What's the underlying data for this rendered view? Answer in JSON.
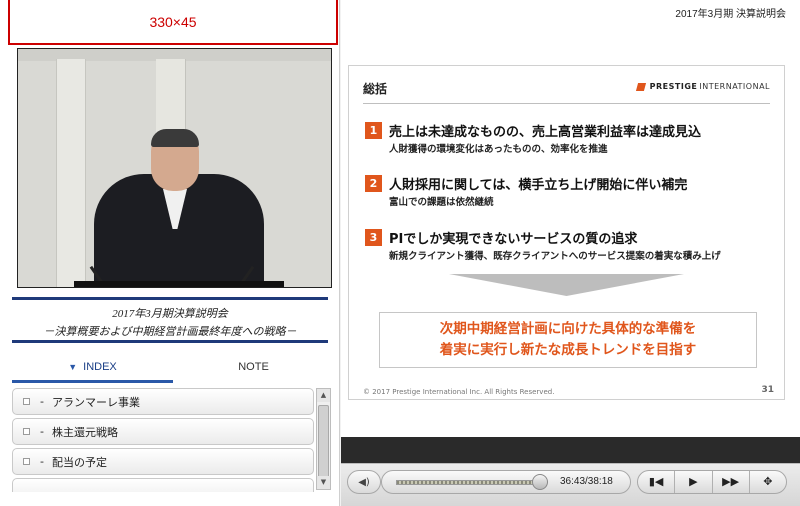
{
  "banner": {
    "text": "330×45"
  },
  "event": {
    "title_line1": "2017年3月期決算説明会",
    "title_line2": "－決算概要および中期経営計画最終年度への戦略－"
  },
  "tabs": [
    {
      "label": "INDEX",
      "active": true
    },
    {
      "label": "NOTE",
      "active": false
    }
  ],
  "index_items": [
    {
      "label": "アランマーレ事業"
    },
    {
      "label": "株主還元戦略"
    },
    {
      "label": "配当の予定"
    }
  ],
  "header": {
    "title": "2017年3月期 決算説明会"
  },
  "slide": {
    "heading": "総括",
    "logo_bold": "PRESTIGE",
    "logo_rest": "INTERNATIONAL",
    "points": [
      {
        "num": "1",
        "main": "売上は未達成なものの、売上高営業利益率は達成見込",
        "sub": "人財獲得の環境変化はあったものの、効率化を推進"
      },
      {
        "num": "2",
        "main": "人財採用に関しては、横手立ち上げ開始に伴い補完",
        "sub": "富山での課題は依然継続"
      },
      {
        "num": "3",
        "main": "PIでしか実現できないサービスの質の追求",
        "sub": "新規クライアント獲得、既存クライアントへのサービス提案の着実な積み上げ"
      }
    ],
    "callout_line1": "次期中期経営計画に向けた具体的な準備を",
    "callout_line2": "着実に実行し新たな成長トレンドを目指す",
    "copyright": "© 2017 Prestige International Inc. All Rights Reserved.",
    "page_number": "31"
  },
  "player": {
    "time": "36:43/38:18",
    "progress_fraction": 0.959,
    "icons": [
      "volume-icon",
      "previous-icon",
      "play-icon",
      "fast-forward-icon",
      "fullscreen-icon"
    ],
    "buttons": {
      "prev": "▮◀",
      "play": "▶",
      "ff": "▶▶",
      "full": "✥",
      "volume": "◀)"
    }
  },
  "colors": {
    "accent": "#e0561c",
    "banner_red": "#cc0000",
    "nav_blue": "#1f3a7a"
  }
}
